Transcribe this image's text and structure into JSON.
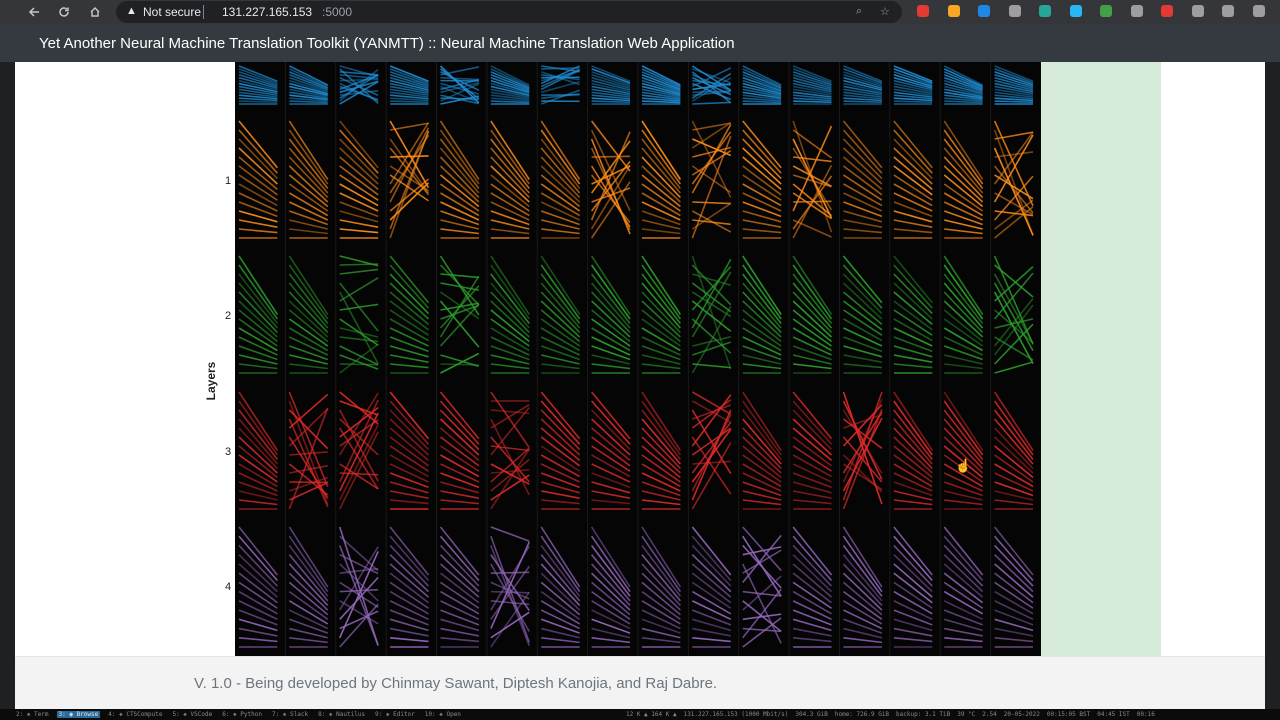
{
  "browser": {
    "security_label": "Not secure",
    "url_host": "131.227.165.153",
    "url_port": ":5000",
    "extension_colors": [
      "#e53935",
      "#f9a825",
      "#1e88e5",
      "#9e9e9e",
      "#26a69a",
      "#29b6f6",
      "#43a047",
      "#9e9e9e",
      "#e53935",
      "#9e9e9e",
      "#9e9e9e",
      "#9e9e9e"
    ]
  },
  "app": {
    "title": "Yet Another Neural Machine Translation Toolkit (YANMTT) :: Neural Machine Translation Web Application"
  },
  "visualization": {
    "axis_title": "Layers",
    "layer_labels": [
      "1",
      "2",
      "3",
      "4"
    ],
    "head_count": 16,
    "layer_colors": [
      "#1f8fd6",
      "#ff8c1a",
      "#2ca02c",
      "#e02a2a",
      "#9467bd"
    ]
  },
  "footer": {
    "text": "V. 1.0 - Being developed by Chinmay Sawant, Diptesh Kanojia, and Raj Dabre."
  },
  "statusbar": {
    "workspaces": [
      {
        "label": "2: ◈ Term",
        "active": false
      },
      {
        "label": "3: ◉ Browse",
        "active": true
      },
      {
        "label": "4: ◈ CTSCompute",
        "active": false
      },
      {
        "label": "5: ◈ VSCode",
        "active": false
      },
      {
        "label": "6: ◈ Python",
        "active": false
      },
      {
        "label": "7: ◈ Slack",
        "active": false
      },
      {
        "label": "8: ◈ Nautilus",
        "active": false
      },
      {
        "label": "9: ◈ Editor",
        "active": false
      },
      {
        "label": "10: ◈ Open",
        "active": false
      }
    ],
    "system_items": [
      "12 K ▲ 164 K ▲",
      "131.227.165.153 (1000 Mbit/s)",
      "304.3 GiB",
      "home: 726.9 GiB",
      "backup: 3.1 TiB",
      "39 °C",
      "2.54",
      "20-05-2022",
      "00:15:05 BST",
      "04:45 IST",
      "00:16"
    ]
  }
}
